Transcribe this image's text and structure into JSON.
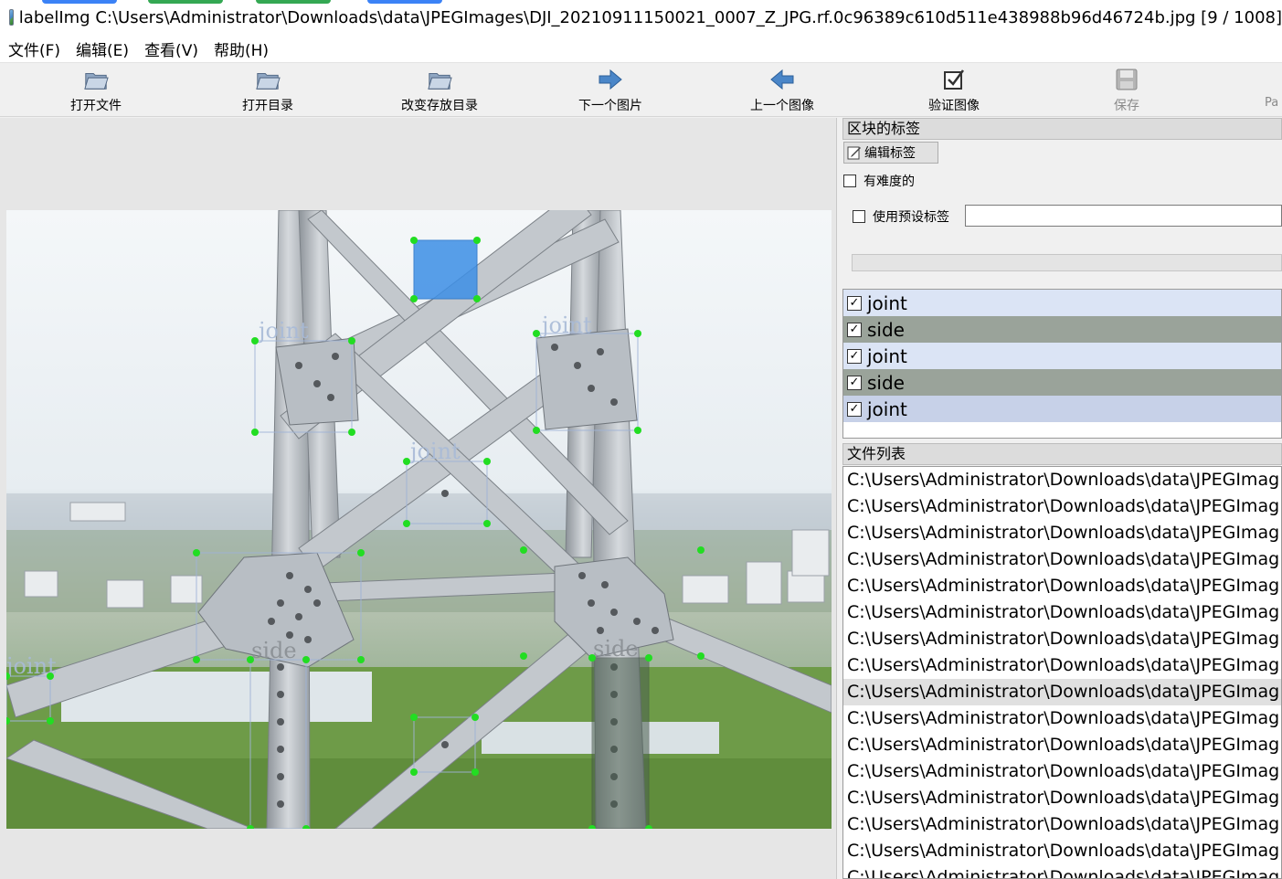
{
  "window": {
    "app_name": "labelImg",
    "title": "labelImg C:\\Users\\Administrator\\Downloads\\data\\JPEGImages\\DJI_20210911150021_0007_Z_JPG.rf.0c96389c610d511e438988b96d46724b.jpg [9 / 1008]"
  },
  "menu": [
    {
      "label": "文件(F)"
    },
    {
      "label": "编辑(E)"
    },
    {
      "label": "查看(V)"
    },
    {
      "label": "帮助(H)"
    }
  ],
  "toolbar": {
    "open_file": "打开文件",
    "open_dir": "打开目录",
    "change_save_dir": "改变存放目录",
    "next_image": "下一个图片",
    "prev_image": "上一个图像",
    "verify_image": "验证图像",
    "save": "保存",
    "partial_next": "Pa"
  },
  "colors": {
    "accent_box": "#3d8fe6",
    "vertex": "#22dd22",
    "side_row": "#9aa39a",
    "joint_row": "#dbe4f5",
    "joint_row_alt": "#c7d1e8"
  },
  "right_panel": {
    "box_labels_header": "区块的标签",
    "edit_label_button": "编辑标签",
    "difficult_checkbox": "有难度的",
    "use_default_label_checkbox": "使用预设标签",
    "default_label_value": "",
    "labels": [
      {
        "name": "joint",
        "checked": true
      },
      {
        "name": "side",
        "checked": true
      },
      {
        "name": "joint",
        "checked": true
      },
      {
        "name": "side",
        "checked": true
      },
      {
        "name": "joint",
        "checked": true
      }
    ],
    "file_list_header": "文件列表",
    "files": [
      "C:\\Users\\Administrator\\Downloads\\data\\JPEGImag",
      "C:\\Users\\Administrator\\Downloads\\data\\JPEGImag",
      "C:\\Users\\Administrator\\Downloads\\data\\JPEGImag",
      "C:\\Users\\Administrator\\Downloads\\data\\JPEGImag",
      "C:\\Users\\Administrator\\Downloads\\data\\JPEGImag",
      "C:\\Users\\Administrator\\Downloads\\data\\JPEGImag",
      "C:\\Users\\Administrator\\Downloads\\data\\JPEGImag",
      "C:\\Users\\Administrator\\Downloads\\data\\JPEGImag",
      "C:\\Users\\Administrator\\Downloads\\data\\JPEGImag",
      "C:\\Users\\Administrator\\Downloads\\data\\JPEGImag",
      "C:\\Users\\Administrator\\Downloads\\data\\JPEGImag",
      "C:\\Users\\Administrator\\Downloads\\data\\JPEGImag",
      "C:\\Users\\Administrator\\Downloads\\data\\JPEGImag",
      "C:\\Users\\Administrator\\Downloads\\data\\JPEGImag",
      "C:\\Users\\Administrator\\Downloads\\data\\JPEGImag",
      "C:\\Users\\Administrator\\Downloads\\data\\JPEGImag"
    ],
    "selected_file_index": 8
  },
  "canvas": {
    "box_labels": [
      "joint",
      "joint",
      "joint",
      "side",
      "side",
      "joint"
    ]
  }
}
